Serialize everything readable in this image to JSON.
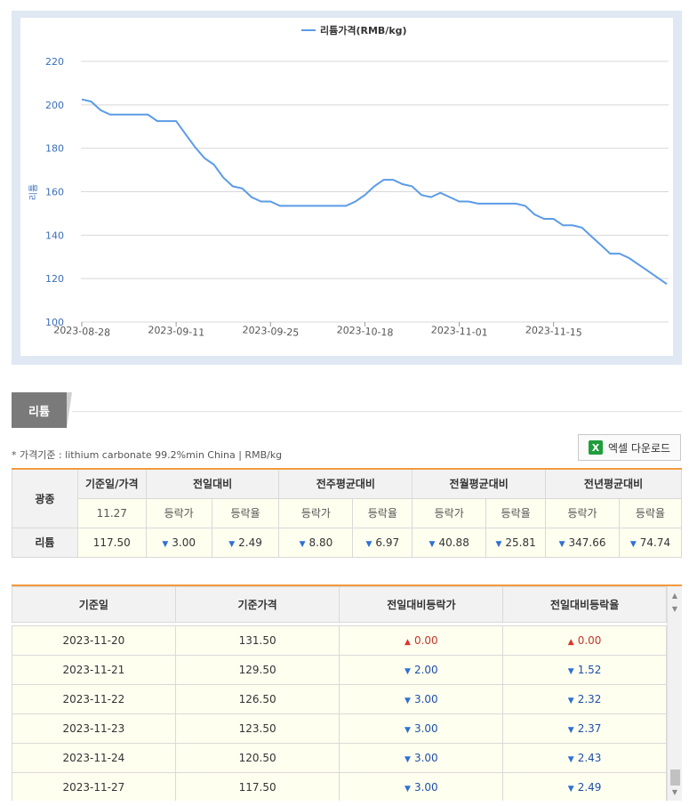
{
  "chart_data": {
    "type": "line",
    "ylabel": "리튬",
    "ylim": [
      100,
      220
    ],
    "yticks": [
      "100",
      "120",
      "140",
      "160",
      "180",
      "200",
      "220"
    ],
    "xticks": [
      "2023-08-28",
      "2023-09-11",
      "2023-09-25",
      "2023-10-18",
      "2023-11-01",
      "2023-11-15"
    ],
    "grid": true,
    "legend_position": "top-center",
    "series": [
      {
        "name": "리튬가격(RMB/kg)",
        "color": "#5b9be6",
        "values": [
          202.5,
          201.5,
          197.5,
          195.5,
          195.5,
          195.5,
          195.5,
          195.5,
          192.5,
          192.5,
          192.5,
          186.5,
          180.5,
          175.5,
          172.5,
          166.5,
          162.5,
          161.5,
          157.5,
          155.5,
          155.5,
          153.5,
          153.5,
          153.5,
          153.5,
          153.5,
          153.5,
          153.5,
          153.5,
          155.5,
          158.5,
          162.5,
          165.5,
          165.5,
          163.5,
          162.5,
          158.5,
          157.5,
          159.5,
          157.5,
          155.5,
          155.5,
          154.5,
          154.5,
          154.5,
          154.5,
          154.5,
          153.5,
          149.5,
          147.5,
          147.5,
          144.5,
          144.5,
          143.5,
          139.5,
          135.5,
          131.5,
          131.5,
          129.5,
          126.5,
          123.5,
          120.5,
          117.5
        ]
      }
    ]
  },
  "section": {
    "title": "리튬"
  },
  "price_basis": "* 가격기준 : lithium carbonate 99.2%min China  |  RMB/kg",
  "excel_button": {
    "label": "엑셀 다운로드",
    "icon": "excel-icon",
    "icon_glyph": "X"
  },
  "summary": {
    "col_mineral": "광종",
    "col_date_price": "기준일/가격",
    "groups": [
      "전일대비",
      "전주평균대비",
      "전월평균대비",
      "전년평균대비"
    ],
    "sub_price": "등락가",
    "sub_rate": "등락율",
    "date": "11.27",
    "mineral": "리튬",
    "price": "117.50",
    "changes": [
      "3.00",
      "2.49",
      "8.80",
      "6.97",
      "40.88",
      "25.81",
      "347.66",
      "74.74"
    ],
    "directions": [
      "down",
      "down",
      "down",
      "down",
      "down",
      "down",
      "down",
      "down"
    ]
  },
  "history": {
    "headers": [
      "기준일",
      "기준가격",
      "전일대비등락가",
      "전일대비등락율"
    ],
    "rows": [
      {
        "date": "2023-11-20",
        "price": "131.50",
        "change": "0.00",
        "rate": "0.00",
        "dir": "up"
      },
      {
        "date": "2023-11-21",
        "price": "129.50",
        "change": "2.00",
        "rate": "1.52",
        "dir": "down"
      },
      {
        "date": "2023-11-22",
        "price": "126.50",
        "change": "3.00",
        "rate": "2.32",
        "dir": "down"
      },
      {
        "date": "2023-11-23",
        "price": "123.50",
        "change": "3.00",
        "rate": "2.37",
        "dir": "down"
      },
      {
        "date": "2023-11-24",
        "price": "120.50",
        "change": "3.00",
        "rate": "2.43",
        "dir": "down"
      },
      {
        "date": "2023-11-27",
        "price": "117.50",
        "change": "3.00",
        "rate": "2.49",
        "dir": "down"
      }
    ]
  },
  "colors": {
    "accent": "#f39a3d",
    "line": "#5b9be6",
    "up": "#d9352b",
    "down": "#2f6fd6"
  }
}
